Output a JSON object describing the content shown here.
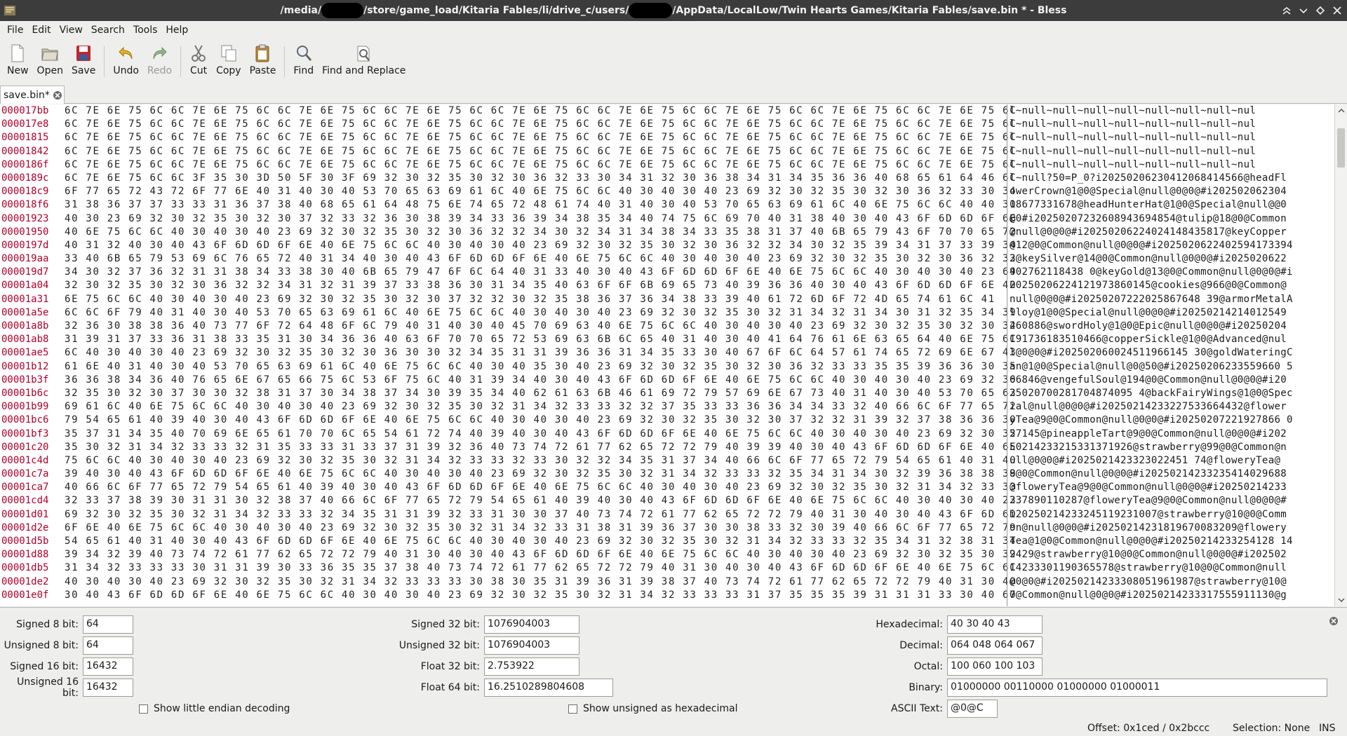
{
  "window": {
    "title_parts": [
      "/media/",
      "/store/game_load/Kitaria Fables/li/drive_c/users/",
      "/AppData/LocalLow/Twin Hearts Games/Kitaria Fables/save.bin * - Bless"
    ]
  },
  "menu": [
    "File",
    "Edit",
    "View",
    "Search",
    "Tools",
    "Help"
  ],
  "toolbar": [
    {
      "label": "New",
      "icon": "new-file-icon"
    },
    {
      "label": "Open",
      "icon": "open-folder-icon"
    },
    {
      "label": "Save",
      "icon": "save-icon"
    },
    {
      "label": "Undo",
      "icon": "undo-icon"
    },
    {
      "label": "Redo",
      "icon": "redo-icon"
    },
    {
      "label": "Cut",
      "icon": "cut-icon"
    },
    {
      "label": "Copy",
      "icon": "copy-icon"
    },
    {
      "label": "Paste",
      "icon": "paste-icon"
    },
    {
      "label": "Find",
      "icon": "find-icon"
    },
    {
      "label": "Find and Replace",
      "icon": "find-replace-icon"
    }
  ],
  "tab": {
    "label": "save.bin*"
  },
  "hex_rows": [
    {
      "offset": "000017bb",
      "hex": "6C 7E 6E 75 6C 6C 7E 6E 75 6C 6C 7E 6E 75 6C 6C 7E 6E 75 6C 6C 7E 6E 75 6C 6C 7E 6E 75 6C 6C 7E 6E 75 6C 6C 7E 6E 75 6C 6C 7E 6E 75 6C",
      "ascii": "l~null~null~null~null~null~null~null~nul"
    },
    {
      "offset": "000017e8",
      "hex": "6C 7E 6E 75 6C 6C 7E 6E 75 6C 6C 7E 6E 75 6C 6C 7E 6E 75 6C 6C 7E 6E 75 6C 6C 7E 6E 75 6C 6C 7E 6E 75 6C 6C 7E 6E 75 6C 6C 7E 6E 75 6C",
      "ascii": "l~null~null~null~null~null~null~null~nul"
    },
    {
      "offset": "00001815",
      "hex": "6C 7E 6E 75 6C 6C 7E 6E 75 6C 6C 7E 6E 75 6C 6C 7E 6E 75 6C 6C 7E 6E 75 6C 6C 7E 6E 75 6C 6C 7E 6E 75 6C 6C 7E 6E 75 6C 6C 7E 6E 75 6C",
      "ascii": "l~null~null~null~null~null~null~null~nul"
    },
    {
      "offset": "00001842",
      "hex": "6C 7E 6E 75 6C 6C 7E 6E 75 6C 6C 7E 6E 75 6C 6C 7E 6E 75 6C 6C 7E 6E 75 6C 6C 7E 6E 75 6C 6C 7E 6E 75 6C 6C 7E 6E 75 6C 6C 7E 6E 75 6C",
      "ascii": "l~null~null~null~null~null~null~null~nul"
    },
    {
      "offset": "0000186f",
      "hex": "6C 7E 6E 75 6C 6C 7E 6E 75 6C 6C 7E 6E 75 6C 6C 7E 6E 75 6C 6C 7E 6E 75 6C 6C 7E 6E 75 6C 6C 7E 6E 75 6C 6C 7E 6E 75 6C 6C 7E 6E 75 6C",
      "ascii": "l~null~null~null~null~null~null~null~nul"
    },
    {
      "offset": "0000189c",
      "hex": "6C 7E 6E 75 6C 6C 3F 35 30 3D 50 5F 30 3F 69 32 30 32 35 30 32 30 36 32 33 30 34 31 32 30 36 38 34 31 34 35 36 36 40 68 65 61 64 46 6C",
      "ascii": "l~null?50=P_0?i20250206230412068414566@headFl"
    },
    {
      "offset": "000018c9",
      "hex": "6F 77 65 72 43 72 6F 77 6E 40 31 40 30 40 53 70 65 63 69 61 6C 40 6E 75 6C 6C 40 30 40 30 40 23 69 32 30 32 35 30 32 30 36 32 33 30 34",
      "ascii": "owerCrown@1@0@Special@null@0@0@#i202502062304"
    },
    {
      "offset": "000018f6",
      "hex": "31 38 36 37 37 33 33 31 36 37 38 40 68 65 61 64 48 75 6E 74 65 72 48 61 74 40 31 40 30 40 53 70 65 63 69 61 6C 40 6E 75 6C 6C 40 40 30",
      "ascii": "18677331678@headHunterHat@1@0@Special@null@@0"
    },
    {
      "offset": "00001923",
      "hex": "40 30 23 69 32 30 32 35 30 32 30 37 32 33 32 36 30 38 39 34 33 36 39 34 38 35 34 40 74 75 6C 69 70 40 31 38 40 30 40 43 6F 6D 6D 6F 6E",
      "ascii": "@0#i20250207232608943694854@tulip@18@0@Common"
    },
    {
      "offset": "00001950",
      "hex": "40 6E 75 6C 6C 40 30 40 30 40 23 69 32 30 32 35 30 32 30 36 32 32 34 30 32 34 31 34 38 34 33 35 38 31 37 40 6B 65 79 43 6F 70 70 65 72",
      "ascii": "@null@0@0@#i20250206224024148435817@keyCopper"
    },
    {
      "offset": "0000197d",
      "hex": "40 31 32 40 30 40 43 6F 6D 6D 6F 6E 40 6E 75 6C 6C 40 30 40 30 40 23 69 32 30 32 35 30 32 30 36 32 32 34 30 32 35 39 34 31 37 33 39 34",
      "ascii": "@12@0@Common@null@0@0@#i2025020622402594173394"
    },
    {
      "offset": "000019aa",
      "hex": "33 40 6B 65 79 53 69 6C 76 65 72 40 31 34 40 30 40 43 6F 6D 6D 6F 6E 40 6E 75 6C 6C 40 30 40 30 40 23 69 32 30 32 35 30 32 30 36 32 32",
      "ascii": "3@keySilver@14@0@Common@null@0@0@#i2025020622"
    },
    {
      "offset": "000019d7",
      "hex": "34 30 32 37 36 32 31 31 38 34 33 38 30 40 6B 65 79 47 6F 6C 64 40 31 33 40 30 40 43 6F 6D 6D 6F 6E 40 6E 75 6C 6C 40 30 40 30 40 23 69",
      "ascii": "402762118438 0@keyGold@13@0@Common@null@0@0@#i"
    },
    {
      "offset": "00001a04",
      "hex": "32 30 32 35 30 32 30 36 32 32 34 31 32 31 39 37 33 38 36 30 31 34 35 40 63 6F 6F 6B 69 65 73 40 39 36 36 40 30 40 43 6F 6D 6D 6F 6E 40",
      "ascii": "20250206224121973860145@cookies@966@0@Common@"
    },
    {
      "offset": "00001a31",
      "hex": "6E 75 6C 6C 40 30 40 30 40 23 69 32 30 32 35 30 32 30 37 32 32 30 32 35 38 36 37 36 34 38 33 39 40 61 72 6D 6F 72 4D 65 74 61 6C 41",
      "ascii": "null@0@0@#i20250207222025867648 39@armorMetalA"
    },
    {
      "offset": "00001a5e",
      "hex": "6C 6C 6F 79 40 31 40 30 40 53 70 65 63 69 61 6C 40 6E 75 6C 6C 40 30 40 30 40 23 69 32 30 32 35 30 32 31 34 32 31 34 30 31 32 35 34 39",
      "ascii": "lloy@1@0@Special@null@0@0@#i20250214214012549"
    },
    {
      "offset": "00001a8b",
      "hex": "32 36 30 38 38 36 40 73 77 6F 72 64 48 6F 6C 79 40 31 40 30 40 45 70 69 63 40 6E 75 6C 6C 40 30 40 30 40 23 69 32 30 32 35 30 32 30 34",
      "ascii": "260886@swordHoly@1@0@Epic@null@0@0@#i20250204"
    },
    {
      "offset": "00001ab8",
      "hex": "31 39 31 37 33 36 31 38 33 35 31 30 34 36 36 40 63 6F 70 70 65 72 53 69 63 6B 6C 65 40 31 40 30 40 41 64 76 61 6E 63 65 64 40 6E 75 6C",
      "ascii": "191736183510466@copperSickle@1@0@Advanced@nul"
    },
    {
      "offset": "00001ae5",
      "hex": "6C 40 30 40 30 40 23 69 32 30 32 35 30 32 30 36 30 30 32 34 35 31 31 39 36 36 31 34 35 33 30 40 67 6F 6C 64 57 61 74 65 72 69 6E 67 43",
      "ascii": "l@0@0@#i202502060024511966145 30@goldWateringC"
    },
    {
      "offset": "00001b12",
      "hex": "61 6E 40 31 40 30 40 53 70 65 63 69 61 6C 40 6E 75 6C 6C 40 30 40 35 30 40 23 69 32 30 32 35 30 32 30 36 32 33 33 35 35 39 36 36 30 35",
      "ascii": "an@1@0@Special@null@0@50@#i20250206233559660 5"
    },
    {
      "offset": "00001b3f",
      "hex": "36 36 38 34 36 40 76 65 6E 67 65 66 75 6C 53 6F 75 6C 40 31 39 34 40 30 40 43 6F 6D 6D 6F 6E 40 6E 75 6C 6C 40 30 40 30 40 23 69 32 30",
      "ascii": "66846@vengefulSoul@194@0@Common@null@0@0@#i20"
    },
    {
      "offset": "00001b6c",
      "hex": "32 35 30 32 30 37 30 30 32 38 31 37 30 34 38 37 34 30 39 35 34 40 62 61 63 6B 46 61 69 72 79 57 69 6E 67 73 40 31 40 30 40 53 70 65 63",
      "ascii": "25020700281704874095 4@backFairyWings@1@0@Spec"
    },
    {
      "offset": "00001b99",
      "hex": "69 61 6C 40 6E 75 6C 6C 40 30 40 30 40 23 69 32 30 32 35 30 32 31 34 32 33 33 32 32 37 35 33 33 36 36 34 34 33 32 40 66 6C 6F 77 65 72",
      "ascii": "ial@null@0@0@#i20250214233227533664432@flower"
    },
    {
      "offset": "00001bc6",
      "hex": "79 54 65 61 40 39 40 30 40 43 6F 6D 6D 6F 6E 40 6E 75 6C 6C 40 30 40 30 40 23 69 32 30 32 35 30 32 30 37 32 32 31 39 32 37 38 36 36 30",
      "ascii": "yTea@9@0@Common@null@0@0@#i20250207221927866 0"
    },
    {
      "offset": "00001bf3",
      "hex": "35 37 31 34 35 40 70 69 6E 65 61 70 70 6C 65 54 61 72 74 40 39 40 30 40 43 6F 6D 6D 6F 6E 40 6E 75 6C 6C 40 30 40 30 40 23 69 32 30 32",
      "ascii": "57145@pineappleTart@9@0@Common@null@0@0@#i202"
    },
    {
      "offset": "00001c20",
      "hex": "35 30 32 31 34 32 33 33 32 31 35 33 33 31 33 37 31 39 32 36 40 73 74 72 61 77 62 65 72 72 79 40 39 39 40 30 40 43 6F 6D 6D 6F 6E 40 6E",
      "ascii": "50214233215331371926@strawberry@99@0@Common@n"
    },
    {
      "offset": "00001c4d",
      "hex": "75 6C 6C 40 30 40 30 40 23 69 32 30 32 35 30 32 31 34 32 33 33 32 33 30 32 32 34 35 31 37 34 40 66 6C 6F 77 65 72 79 54 65 61 40 31 40",
      "ascii": "ull@0@0@#i2025021423323022451 74@floweryTea@"
    },
    {
      "offset": "00001c7a",
      "hex": "39 40 30 40 43 6F 6D 6D 6F 6E 40 6E 75 6C 6C 40 30 40 30 40 23 69 32 30 32 35 30 32 31 34 32 33 33 32 35 34 31 34 30 32 39 36 38 38 38",
      "ascii": "9@0@Common@null@0@0@#i20250214233235414029688"
    },
    {
      "offset": "00001ca7",
      "hex": "40 66 6C 6F 77 65 72 79 54 65 61 40 39 40 30 40 43 6F 6D 6D 6F 6E 40 6E 75 6C 6C 40 30 40 30 40 23 69 32 30 32 35 30 32 31 34 32 33 33",
      "ascii": "@floweryTea@9@0@Common@null@0@0@#i20250214233"
    },
    {
      "offset": "00001cd4",
      "hex": "32 33 37 38 39 30 31 31 30 32 38 37 40 66 6C 6F 77 65 72 79 54 65 61 40 39 40 30 40 43 6F 6D 6D 6F 6E 40 6E 75 6C 6C 40 30 40 30 40 23",
      "ascii": "237890110287@floweryTea@9@0@Common@null@0@0@#"
    },
    {
      "offset": "00001d01",
      "hex": "69 32 30 32 35 30 32 31 34 32 33 33 32 34 35 31 31 39 32 33 31 30 30 37 40 73 74 72 61 77 62 65 72 72 79 40 31 30 40 30 40 43 6F 6D 6D",
      "ascii": "i20250214233245119231007@strawberry@10@0@Comm"
    },
    {
      "offset": "00001d2e",
      "hex": "6F 6E 40 6E 75 6C 6C 40 30 40 30 40 23 69 32 30 32 35 30 32 31 34 32 33 31 38 31 39 36 37 30 30 38 33 32 30 39 40 66 6C 6F 77 65 72 79",
      "ascii": "on@null@0@0@#i20250214231819670083209@flowery"
    },
    {
      "offset": "00001d5b",
      "hex": "54 65 61 40 31 40 30 40 43 6F 6D 6D 6F 6E 40 6E 75 6C 6C 40 30 40 30 40 23 69 32 30 32 35 30 32 31 34 32 33 33 32 35 34 31 32 38 31 34",
      "ascii": "Tea@1@0@Common@null@0@0@#i20250214233254128 14"
    },
    {
      "offset": "00001d88",
      "hex": "39 34 32 39 40 73 74 72 61 77 62 65 72 72 79 40 31 30 40 30 40 43 6F 6D 6D 6F 6E 40 6E 75 6C 6C 40 30 40 30 40 23 69 32 30 32 35 30 32",
      "ascii": "9429@strawberry@10@0@Common@null@0@0@#i202502"
    },
    {
      "offset": "00001db5",
      "hex": "31 34 32 33 33 33 30 31 31 39 30 33 36 35 35 37 38 40 73 74 72 61 77 62 65 72 72 79 40 31 30 40 30 40 43 6F 6D 6D 6F 6E 40 6E 75 6C 6C",
      "ascii": "14233301190365578@strawberry@10@0@Common@null"
    },
    {
      "offset": "00001de2",
      "hex": "40 30 40 30 40 23 69 32 30 32 35 30 32 31 34 32 33 33 33 30 38 30 35 31 39 36 31 39 38 37 40 73 74 72 61 77 62 65 72 72 79 40 31 30 40",
      "ascii": "@0@0@#i20250214233308051961987@strawberry@10@"
    },
    {
      "offset": "00001e0f",
      "hex": "30 40 43 6F 6D 6D 6F 6E 40 6E 75 6C 6C 40 30 40 30 40 23 69 32 30 32 35 30 32 31 34 32 33 33 33 31 37 35 35 35 39 31 31 31 33 30 40 67",
      "ascii": "0@Common@null@0@0@#i20250214233317555911130@g"
    }
  ],
  "conversion": {
    "signed8_label": "Signed 8 bit:",
    "signed8": "64",
    "unsigned8_label": "Unsigned 8 bit:",
    "unsigned8": "64",
    "signed16_label": "Signed 16 bit:",
    "signed16": "16432",
    "unsigned16_label": "Unsigned 16 bit:",
    "unsigned16": "16432",
    "signed32_label": "Signed 32 bit:",
    "signed32": "1076904003",
    "unsigned32_label": "Unsigned 32 bit:",
    "unsigned32": "1076904003",
    "float32_label": "Float 32 bit:",
    "float32": "2.753922",
    "float64_label": "Float 64 bit:",
    "float64": "16.2510289804608",
    "hex_label": "Hexadecimal:",
    "hex": "40 30 40 43",
    "decimal_label": "Decimal:",
    "decimal": "064 048 064 067",
    "octal_label": "Octal:",
    "octal": "100 060 100 103",
    "binary_label": "Binary:",
    "binary": "01000000 00110000 01000000 01000011",
    "ascii_label": "ASCII Text:",
    "ascii": "@0@C",
    "little_endian_label": "Show little endian decoding",
    "unsigned_hex_label": "Show unsigned as hexadecimal"
  },
  "status": {
    "offset": "Offset: 0x1ced / 0x2bccc",
    "selection": "Selection: None",
    "mode": "INS"
  }
}
